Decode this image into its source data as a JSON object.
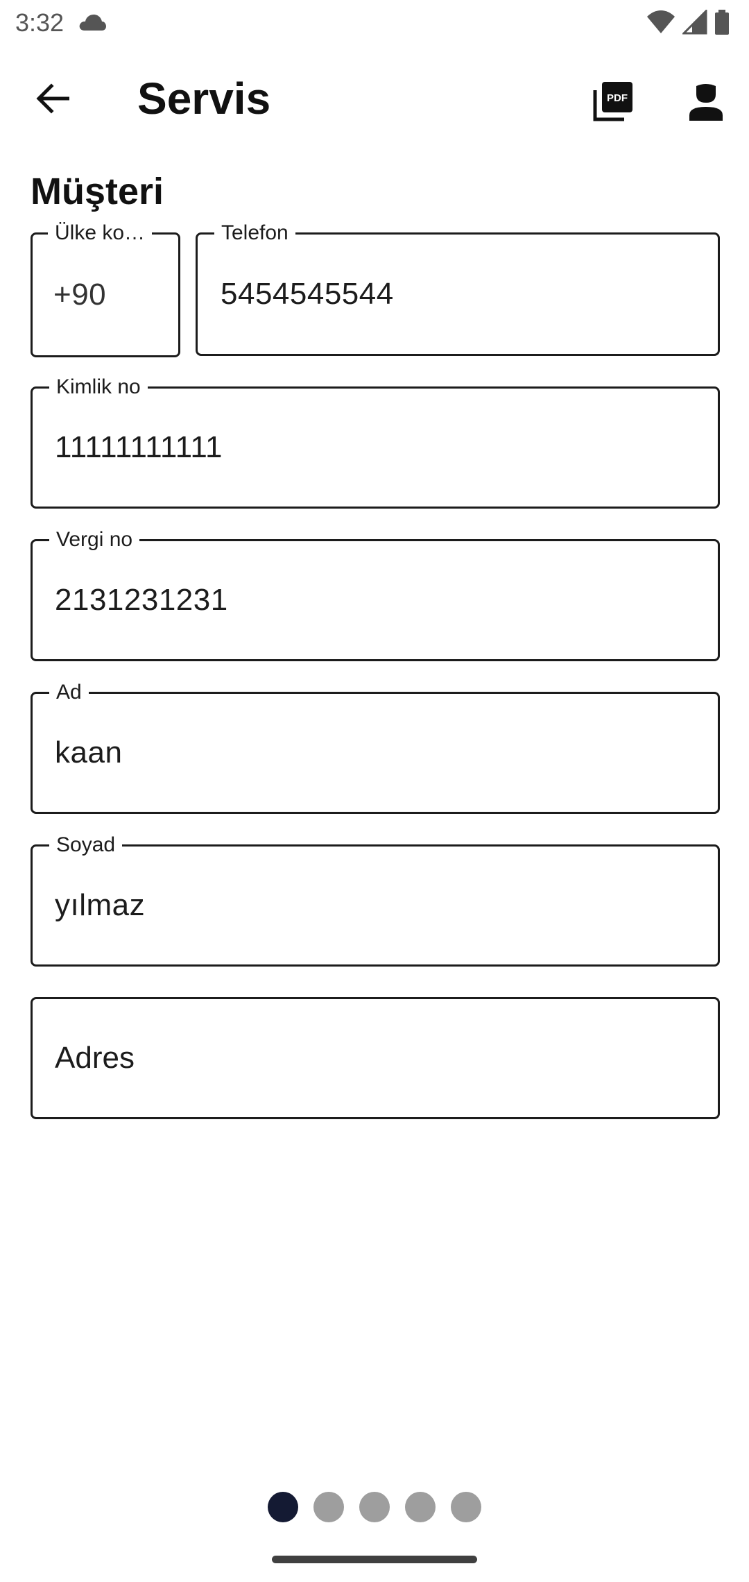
{
  "status_bar": {
    "time": "3:32",
    "icons": [
      "cloud-icon",
      "wifi-icon",
      "signal-icon",
      "battery-icon"
    ]
  },
  "app_bar": {
    "title": "Servis",
    "back_icon": "arrow-left-icon",
    "pdf_icon": "pdf-icon",
    "person_icon": "person-icon"
  },
  "section": {
    "title": "Müşteri"
  },
  "fields": {
    "country_code": {
      "label": "Ülke ko…",
      "value": "+90"
    },
    "phone": {
      "label": "Telefon",
      "value": "5454545544"
    },
    "id_no": {
      "label": "Kimlik no",
      "value": "11111111111"
    },
    "tax_no": {
      "label": "Vergi no",
      "value": "2131231231"
    },
    "first_name": {
      "label": "Ad",
      "value": "kaan"
    },
    "last_name": {
      "label": "Soyad",
      "value": "yılmaz"
    },
    "address": {
      "placeholder": "Adres",
      "value": ""
    }
  },
  "pagination": {
    "total_pages": 5,
    "current_page": 1
  },
  "colors": {
    "text": "#1c1c1c",
    "active_dot": "#141a33",
    "inactive_dot": "#9e9e9e"
  }
}
